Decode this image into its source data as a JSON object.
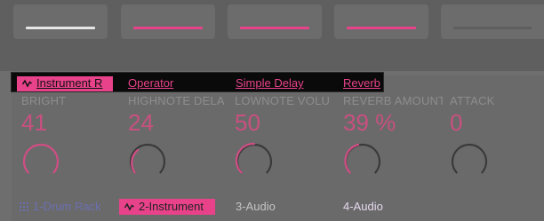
{
  "colors": {
    "accent": "#e8438a",
    "value": "#c8507f",
    "dim_text": "#8d8d8d"
  },
  "mixer_pads": [
    {
      "line_color": "#e6e6e6"
    },
    {
      "line_color": "#e8438a"
    },
    {
      "line_color": "#e8438a"
    },
    {
      "line_color": "#e8438a"
    },
    {
      "line_color": "#5e5e5e"
    }
  ],
  "breadcrumb": {
    "items": [
      {
        "label": "Instrument R",
        "active": true,
        "icon": "waveform-icon"
      },
      {
        "label": "Operator",
        "active": false
      },
      {
        "label": "Simple Delay",
        "active": false
      },
      {
        "label": "Reverb",
        "active": false
      }
    ]
  },
  "params": [
    {
      "name": "BRIGHT",
      "value": "41"
    },
    {
      "name": "HIGHNOTE DELA",
      "value": "24"
    },
    {
      "name": "LOWNOTE VOLU",
      "value": "50"
    },
    {
      "name": "REVERB AMOUNT",
      "value": "39 %"
    },
    {
      "name": "ATTACK",
      "value": "0"
    }
  ],
  "tracks": [
    {
      "label": "1-Drum Rack",
      "icon": "grid-icon",
      "color": "#6b6fb0"
    },
    {
      "label": "2-Instrument",
      "icon": "waveform-icon",
      "active": true
    },
    {
      "label": "3-Audio",
      "color": "#c4c4c4"
    },
    {
      "label": "4-Audio",
      "color": "#e6d8ee"
    }
  ]
}
